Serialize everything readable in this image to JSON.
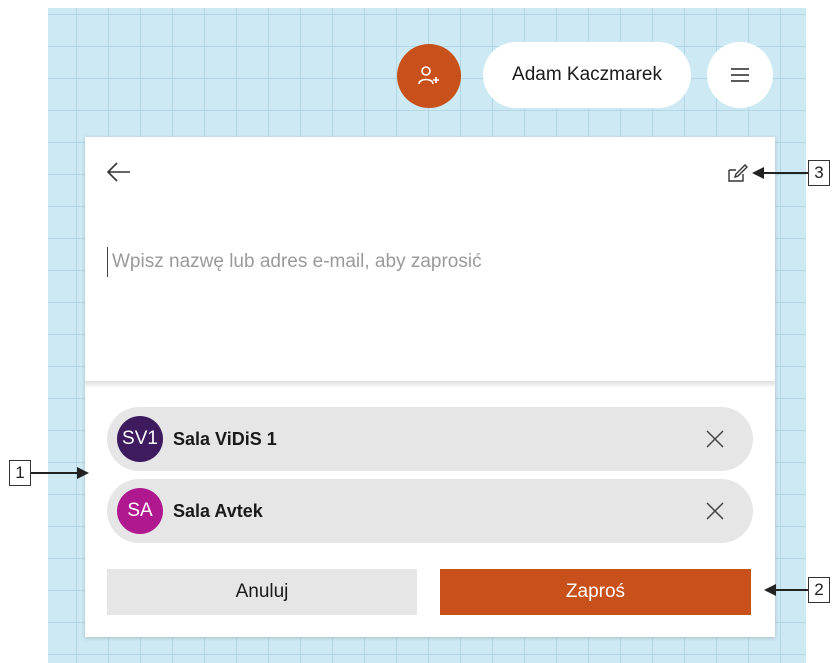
{
  "header": {
    "add_person_icon": "person-add-icon",
    "user_name": "Adam Kaczmarek",
    "menu_icon": "hamburger-icon"
  },
  "panel": {
    "back_icon": "arrow-left-icon",
    "edit_icon": "pencil-square-icon",
    "search": {
      "placeholder": "Wpisz nazwę lub adres e-mail, aby zaprosić",
      "value": ""
    },
    "invitees": [
      {
        "initials": "SV1",
        "name": "Sala ViDiS 1",
        "avatar_color": "#3d1b5e"
      },
      {
        "initials": "SA",
        "name": "Sala Avtek",
        "avatar_color": "#b0188f"
      }
    ],
    "cancel_label": "Anuluj",
    "invite_label": "Zaproś"
  },
  "callouts": [
    "1",
    "2",
    "3"
  ],
  "colors": {
    "accent": "#c8501a",
    "background": "#cde9f4",
    "chip": "#e6e6e6"
  }
}
